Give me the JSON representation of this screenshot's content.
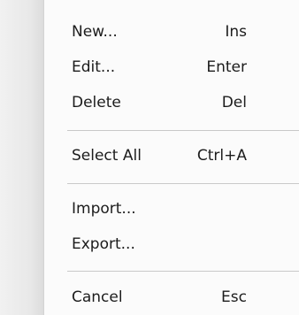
{
  "menu": {
    "items": [
      {
        "label": "New...",
        "shortcut": "Ins"
      },
      {
        "label": "Edit...",
        "shortcut": "Enter"
      },
      {
        "label": "Delete",
        "shortcut": "Del"
      },
      {
        "label": "Select All",
        "shortcut": "Ctrl+A"
      },
      {
        "label": "Import...",
        "shortcut": ""
      },
      {
        "label": "Export...",
        "shortcut": ""
      },
      {
        "label": "Cancel",
        "shortcut": "Esc"
      }
    ]
  }
}
